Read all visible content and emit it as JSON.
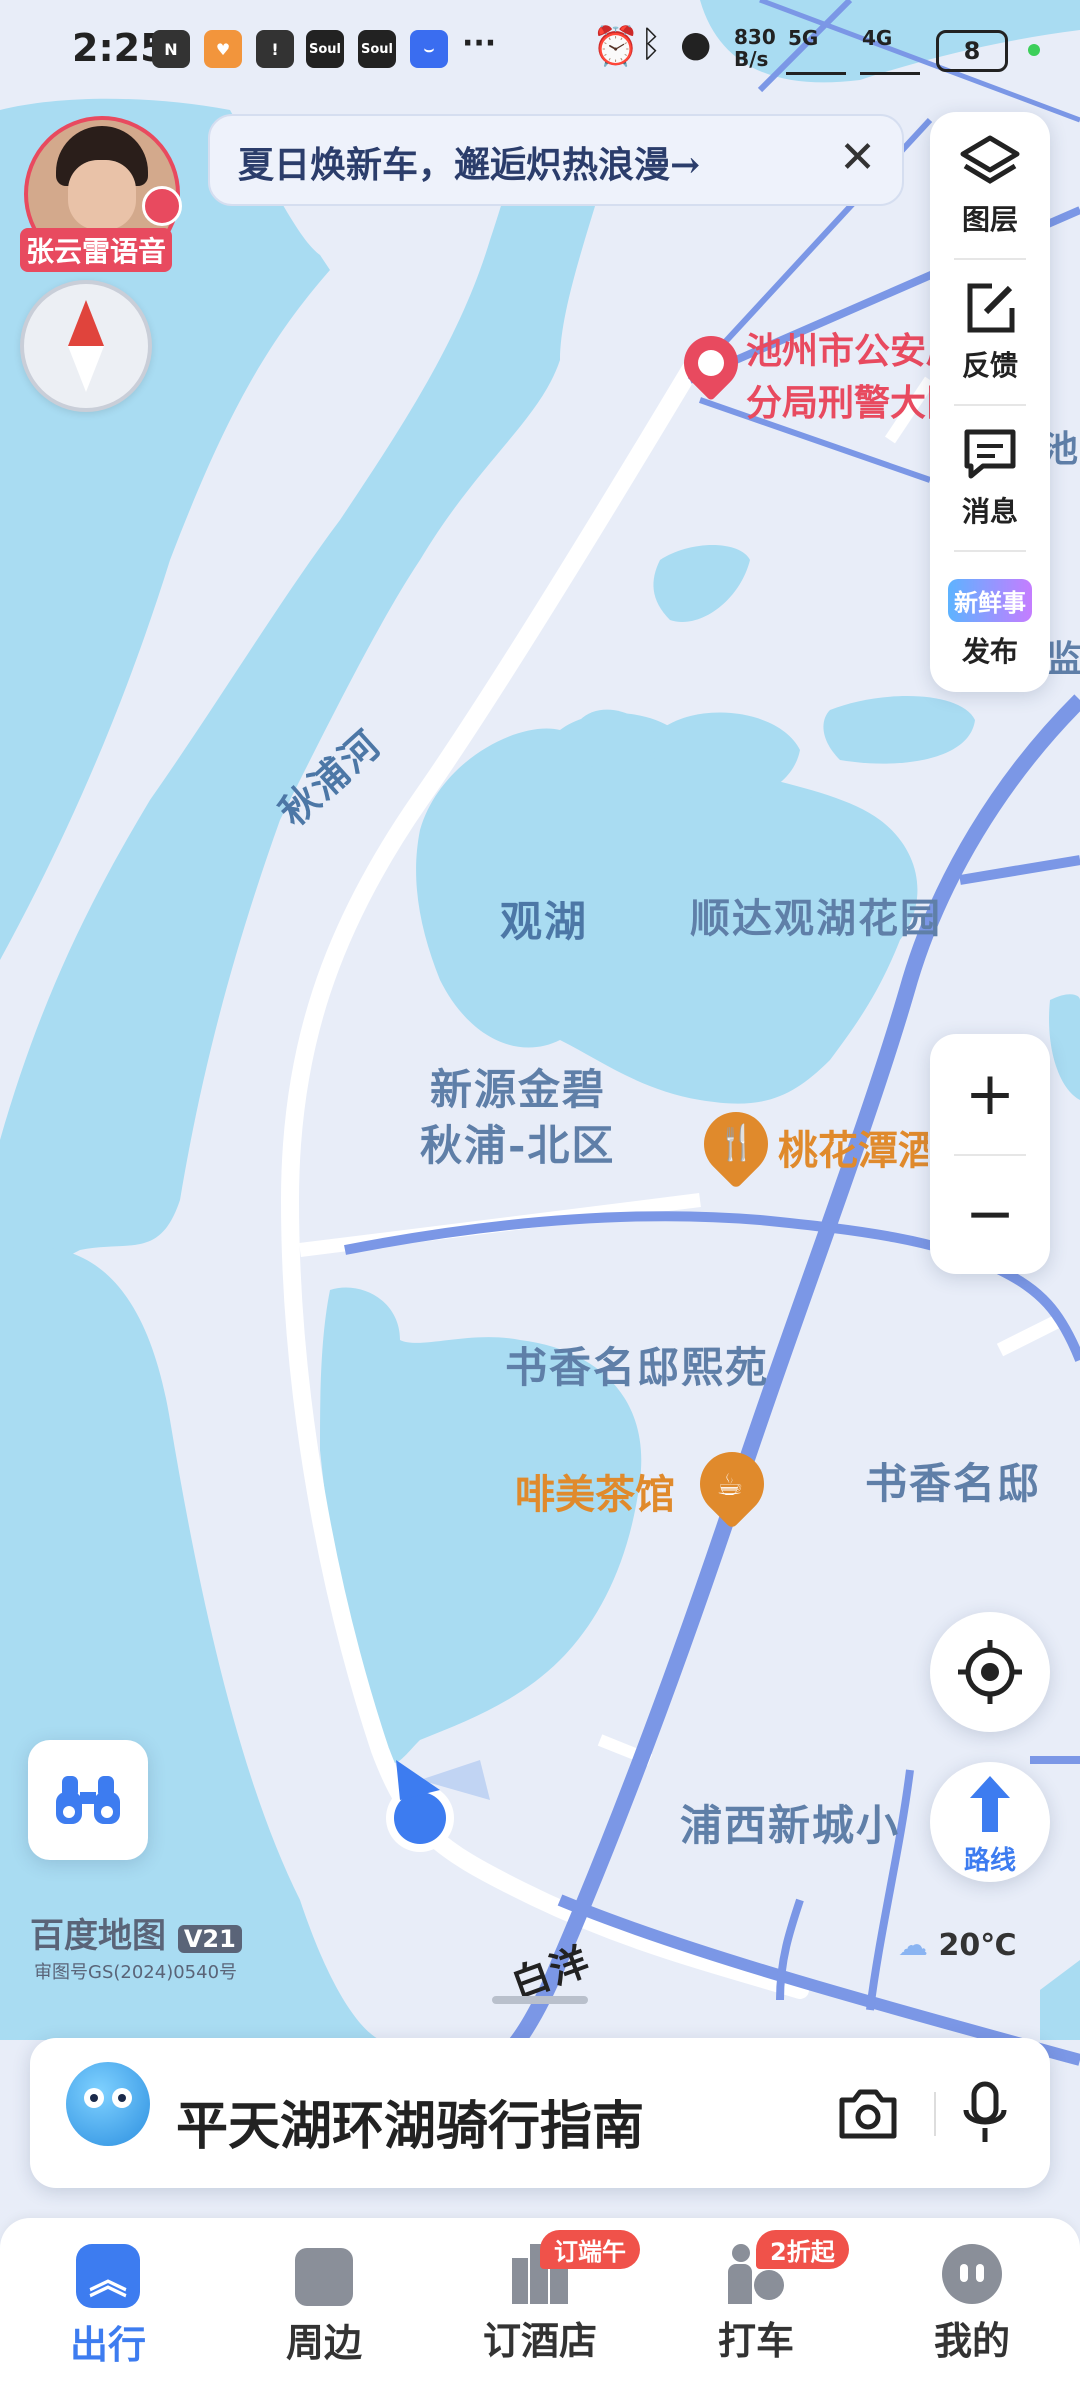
{
  "status_bar": {
    "time": "2:25",
    "network_speed_top": "830",
    "network_speed_bottom": "B/s",
    "signal1": "5G",
    "signal2": "4G",
    "battery": "8"
  },
  "banner": {
    "text": "夏日焕新车，邂逅炽热浪漫→",
    "close_icon": "close-icon"
  },
  "voice_avatar": {
    "label": "张云雷语音"
  },
  "right_toolbar": {
    "items": [
      {
        "label": "图层",
        "icon": "layers-icon"
      },
      {
        "label": "反馈",
        "icon": "feedback-icon"
      },
      {
        "label": "消息",
        "icon": "message-icon"
      },
      {
        "label": "发布",
        "icon": "publish-icon",
        "badge_text": "新鲜事"
      }
    ]
  },
  "zoom": {
    "in_label": "+",
    "out_label": "−"
  },
  "route_button": {
    "label": "路线"
  },
  "map": {
    "labels": {
      "river": "秋浦河",
      "lake": "观湖",
      "community1": "顺达观湖花园",
      "community2_line1": "新源金碧",
      "community2_line2": "秋浦-北区",
      "community3": "书香名邸熙苑",
      "community4": "书香名邸",
      "community5": "浦西新城小区",
      "road": "白洋",
      "edge1": "池",
      "edge2": "监"
    },
    "pois": {
      "police_line1": "池州市公安局",
      "police_line2": "分局刑警大队",
      "restaurant": "桃花潭酒",
      "teahouse": "啡美茶馆"
    },
    "brand": "百度地图",
    "brand_version": "V21",
    "approval": "审图号GS(2024)0540号",
    "weather": "20℃",
    "colors": {
      "water": "#a9dcf2",
      "land": "#e8edf8",
      "road_main": "#7b97e6",
      "poi_orange": "#e08a2c",
      "poi_red": "#e84a5f"
    }
  },
  "search_bar": {
    "text": "平天湖环湖骑行指南"
  },
  "tab_bar": {
    "tabs": [
      {
        "label": "出行",
        "active": true
      },
      {
        "label": "周边"
      },
      {
        "label": "订酒店",
        "badge": "订端午"
      },
      {
        "label": "打车",
        "badge": "2折起"
      },
      {
        "label": "我的"
      }
    ]
  }
}
